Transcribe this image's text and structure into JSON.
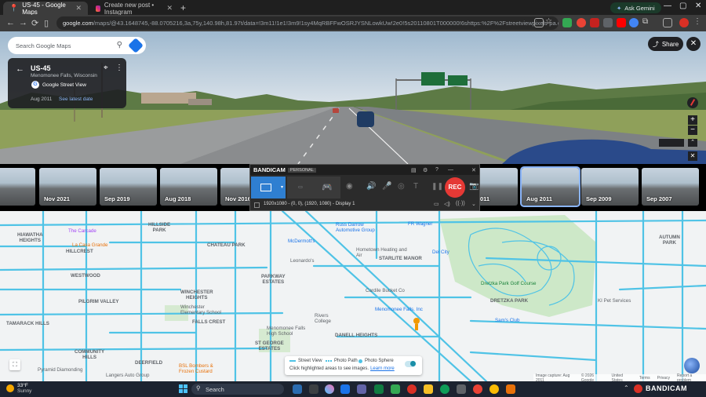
{
  "browser": {
    "tabs": [
      {
        "label": "US-45 - Google Maps",
        "active": true
      },
      {
        "label": "Create new post • Instagram",
        "active": false
      }
    ],
    "ask_gemini": "Ask Gemini",
    "url_host": "google.com",
    "url_path": "/maps/@43.1648745,-88.0705216,3a,75y,140.98h,81.97t/data=!3m11!1e1!3m9!1sy4MqRBFFwOSRJYSNLowkUw!2e0!5s20110801T000000!6shttps:%2F%2Fstreetviewpixels-pa.googleapis.co..."
  },
  "streetview": {
    "search_placeholder": "Search Google Maps",
    "card": {
      "title": "US-45",
      "subtitle": "Menomonee Falls, Wisconsin",
      "source": "Google Street View",
      "date": "Aug 2011",
      "latest_link": "See latest date"
    },
    "share_label": "Share",
    "close_glyph": "✕"
  },
  "timeline": {
    "thumbs": [
      {
        "label": "2"
      },
      {
        "label": "Nov 2021"
      },
      {
        "label": "Sep 2019"
      },
      {
        "label": "Aug 2018"
      },
      {
        "label": "Nov 2016"
      },
      {
        "label": "011"
      },
      {
        "label": "Aug 2011"
      },
      {
        "label": "Sep 2009"
      },
      {
        "label": "Sep 2007"
      }
    ],
    "selected_index": 6
  },
  "bandicam": {
    "brand": "BANDICAM",
    "edition": "PERSONAL",
    "rec_label": "REC",
    "status_text": "1920x1080 - (0, 0), (1920, 1080) - Display 1"
  },
  "map": {
    "areas": [
      "HIAWATHA\nHEIGHTS",
      "HILLCREST",
      "WESTWOOD",
      "PILGRIM VALLEY",
      "TAMARACK HILLS",
      "COMMUNITY\nHILLS",
      "DEERFIELD",
      "CHATEAU PARK",
      "PARKWAY\nESTATES",
      "WINCHESTER\nHEIGHTS",
      "FALLS CREST",
      "ST GEORGE\nESTATES",
      "DANELL HEIGHTS",
      "STARLITE MANOR",
      "DRETZKA PARK",
      "HILLSIDE\nPARK",
      "AUTUMN\nPARK"
    ],
    "places": [
      "The Carcade",
      "La Casa Grande",
      "Russ Darrow\nAutomotive Group",
      "McDermott's",
      "Hometown Heating and Air",
      "Leonardo's",
      "Cardile Bucket Co",
      "Sam's Club",
      "Menomonee Falls\nHigh School",
      "Winchester\nElementary School",
      "Rivers\nCollege",
      "BSL Bombers &\nFrozen Custard",
      "Langers Auto Group",
      "Pyramid Diamonding",
      "Del City",
      "KI Pet Services",
      "Dretzka Park Golf Course",
      "Menomonee Falls, Inc",
      "FR Wagner"
    ],
    "legend": {
      "street_view": "Street View",
      "photo_path": "Photo Path",
      "photo_sphere": "Photo Sphere",
      "hint": "Click highlighted areas to see images.",
      "learn_more": "Learn more"
    },
    "attribution": [
      "Image capture: Aug 2011",
      "© 2026 Google",
      "United States",
      "Terms",
      "Privacy",
      "Report a problem"
    ],
    "route_color": "#4fc3e6"
  },
  "taskbar": {
    "weather_temp": "33°F",
    "weather_desc": "Sunny",
    "search_label": "Search",
    "tray_brand": "BANDICAM"
  }
}
